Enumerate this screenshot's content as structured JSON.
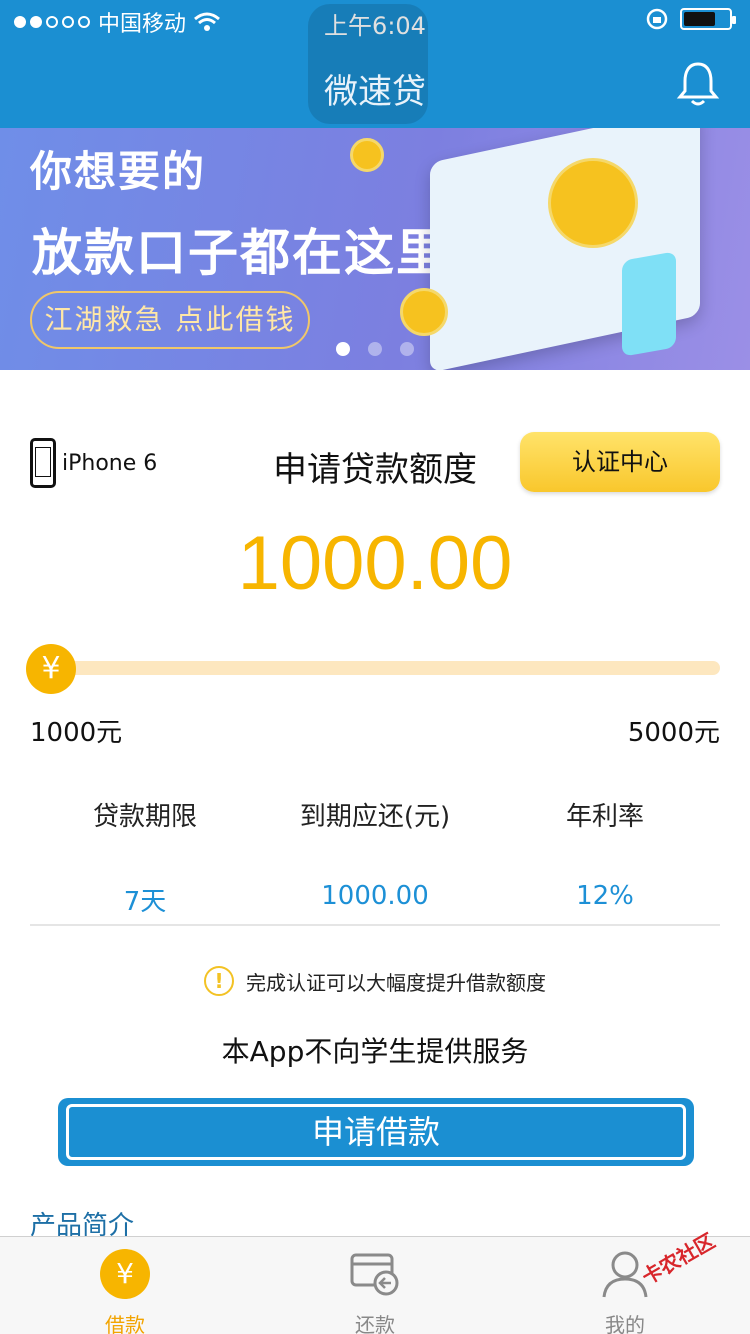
{
  "status_bar": {
    "carrier": "中国移动",
    "time": "上午6:04"
  },
  "header": {
    "title": "微速贷"
  },
  "banner": {
    "line1": "你想要的",
    "line2": "放款口子都在这里",
    "pill": "江湖救急 点此借钱",
    "page_index": 1,
    "page_count": 3
  },
  "loan": {
    "device": "iPhone 6",
    "title": "申请贷款额度",
    "cert_button": "认证中心",
    "amount": "1000.00",
    "slider_fraction": 0,
    "min_label": "1000元",
    "max_label": "5000元",
    "stats": [
      {
        "label": "贷款期限",
        "value": "7天"
      },
      {
        "label": "到期应还(元)",
        "value": "1000.00"
      },
      {
        "label": "年利率",
        "value": "12%"
      }
    ],
    "notice": "完成认证可以大幅度提升借款额度",
    "student_notice": "本App不向学生提供服务",
    "apply_button": "申请借款",
    "intro_heading": "产品简介"
  },
  "tabbar": {
    "tabs": [
      {
        "label": "借款",
        "icon": "yen-icon",
        "active": true
      },
      {
        "label": "还款",
        "icon": "repay-card-icon",
        "active": false
      },
      {
        "label": "我的",
        "icon": "user-icon",
        "active": false
      }
    ]
  },
  "watermark": "卡农社区",
  "colors": {
    "brand_blue": "#1b8fd2",
    "accent_yellow": "#f7b500",
    "value_blue": "#1d90d6"
  }
}
